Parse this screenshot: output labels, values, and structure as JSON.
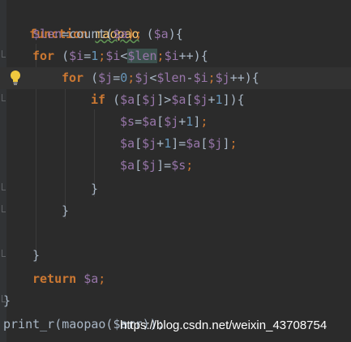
{
  "code": {
    "line1": {
      "kw": "function",
      "name": "maopao",
      "open": " (",
      "param": "$a",
      "close": "){"
    },
    "line2": {
      "var": "$len",
      "eq": "=count(",
      "arg": "$a",
      "close": ");"
    },
    "line3": {
      "kw": "for",
      "p1": " (",
      "v1": "$i",
      "eq": "=",
      "n1": "1",
      "s1": ";",
      "v2": "$i",
      "lt": "<",
      "v3": "$len",
      "s2": ";",
      "v4": "$i",
      "inc": "++){"
    },
    "line4": {
      "kw": "for",
      "p1": " (",
      "v1": "$j",
      "eq": "=",
      "n1": "0",
      "s1": ";",
      "v2": "$j",
      "lt": "<",
      "v3": "$len",
      "minus": "-",
      "v4": "$i",
      "s2": ";",
      "v5": "$j",
      "inc": "++){"
    },
    "line5": {
      "kw": "if",
      "p1": " (",
      "v1": "$a",
      "b1": "[",
      "v2": "$j",
      "b2": "]>",
      "v3": "$a",
      "b3": "[",
      "v4": "$j",
      "plus": "+",
      "n1": "1",
      "b4": "]){"
    },
    "line6": {
      "v1": "$s",
      "eq": "=",
      "v2": "$a",
      "b1": "[",
      "v3": "$j",
      "plus": "+",
      "n1": "1",
      "b2": "]",
      "semi": ";"
    },
    "line7": {
      "v1": "$a",
      "b1": "[",
      "v2": "$j",
      "plus": "+",
      "n1": "1",
      "b2": "]=",
      "v3": "$a",
      "b3": "[",
      "v4": "$j",
      "b4": "]",
      "semi": ";"
    },
    "line8": {
      "v1": "$a",
      "b1": "[",
      "v2": "$j",
      "b2": "]=",
      "v3": "$s",
      "semi": ";"
    },
    "line9": {
      "brace": "}"
    },
    "line10": {
      "brace": "}"
    },
    "line12": {
      "brace": "}"
    },
    "line13": {
      "kw": "return",
      "var": " $a",
      "semi": ";"
    },
    "line14": {
      "brace": "}"
    },
    "line15": {
      "text": "print_r(maopao($arr));"
    }
  },
  "watermark": "https://blog.csdn.net/weixin_43708754",
  "icons": {
    "bulb": "lightbulb-icon"
  }
}
